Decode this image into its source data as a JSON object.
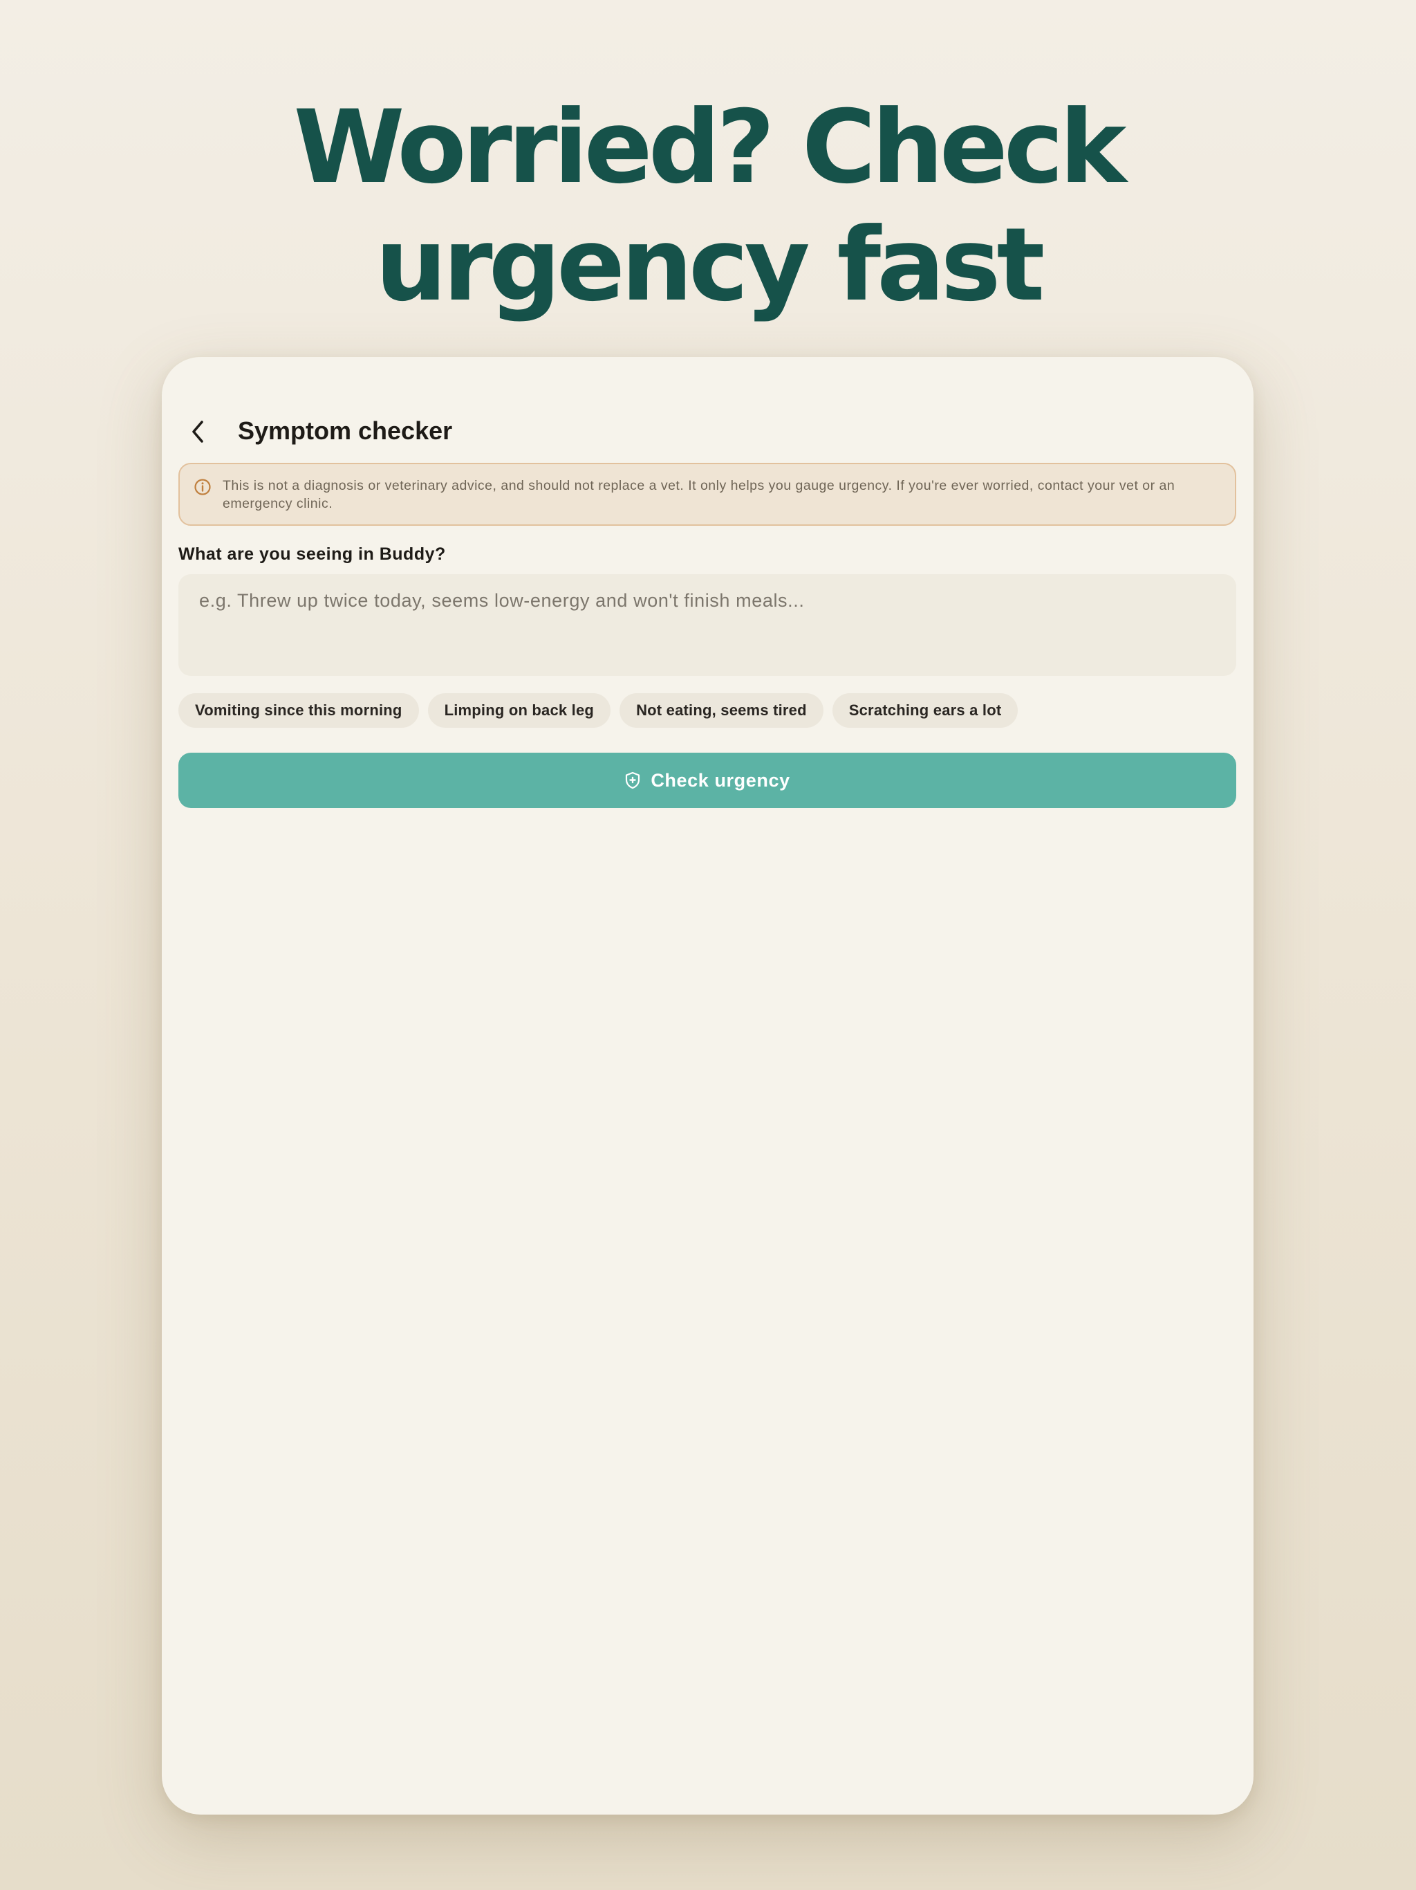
{
  "headline": {
    "line1": "Worried? Check",
    "line2": "urgency fast"
  },
  "screen": {
    "title": "Symptom checker",
    "back_icon": "chevron-left-icon"
  },
  "disclaimer": {
    "icon": "info-circle-icon",
    "text": "This is not a diagnosis or veterinary advice, and should not replace a vet. It only helps you gauge urgency. If you're ever worried, contact your vet or an emergency clinic."
  },
  "symptom_form": {
    "label": "What are you seeing in Buddy?",
    "value": "",
    "placeholder": "e.g. Threw up twice today, seems low-energy and won't finish meals..."
  },
  "suggestions": [
    "Vomiting since this morning",
    "Limping on back leg",
    "Not eating, seems tired",
    "Scratching ears a lot"
  ],
  "cta": {
    "label": "Check urgency",
    "icon": "shield-plus-icon"
  },
  "colors": {
    "headline": "#16524a",
    "accent_button": "#5cb3a5",
    "disclaimer_bg": "#efe4d4",
    "disclaimer_border": "#e2c19d",
    "info_icon": "#c0803f",
    "card_bg": "#f6f3eb"
  }
}
